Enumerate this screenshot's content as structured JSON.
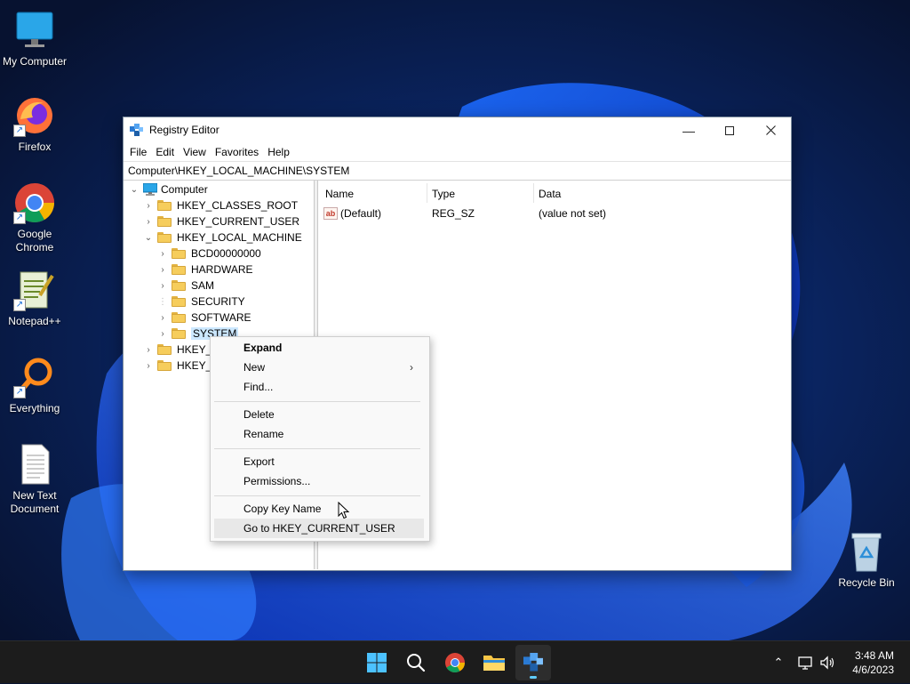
{
  "desktop": {
    "icons": [
      {
        "label": "My Computer",
        "icon": "monitor-icon"
      },
      {
        "label": "Firefox",
        "icon": "firefox-icon"
      },
      {
        "label": "Google Chrome",
        "icon": "chrome-icon"
      },
      {
        "label": "Notepad++",
        "icon": "notepadpp-icon"
      },
      {
        "label": "Everything",
        "icon": "everything-search-icon"
      },
      {
        "label": "New Text Document",
        "icon": "text-document-icon"
      },
      {
        "label": "Recycle Bin",
        "icon": "recycle-bin-icon"
      }
    ]
  },
  "window": {
    "title": "Registry Editor",
    "menu": [
      "File",
      "Edit",
      "View",
      "Favorites",
      "Help"
    ],
    "address": "Computer\\HKEY_LOCAL_MACHINE\\SYSTEM",
    "tree": [
      {
        "label": "Computer",
        "level": 0,
        "expanded": true
      },
      {
        "label": "HKEY_CLASSES_ROOT",
        "level": 1
      },
      {
        "label": "HKEY_CURRENT_USER",
        "level": 1
      },
      {
        "label": "HKEY_LOCAL_MACHINE",
        "level": 1,
        "expanded": true
      },
      {
        "label": "BCD00000000",
        "level": 2
      },
      {
        "label": "HARDWARE",
        "level": 2
      },
      {
        "label": "SAM",
        "level": 2
      },
      {
        "label": "SECURITY",
        "level": 2
      },
      {
        "label": "SOFTWARE",
        "level": 2
      },
      {
        "label": "SYSTEM",
        "level": 2,
        "selected": true
      },
      {
        "label": "HKEY_U",
        "level": 1
      },
      {
        "label": "HKEY_C",
        "level": 1
      }
    ],
    "columns": {
      "name": "Name",
      "type": "Type",
      "data": "Data"
    },
    "values": [
      {
        "name": "(Default)",
        "type": "REG_SZ",
        "data": "(value not set)"
      }
    ]
  },
  "context_menu": {
    "expand": "Expand",
    "new": "New",
    "find": "Find...",
    "delete": "Delete",
    "rename": "Rename",
    "export": "Export",
    "permissions": "Permissions...",
    "copy_key_name": "Copy Key Name",
    "goto": "Go to HKEY_CURRENT_USER"
  },
  "taskbar": {
    "apps": [
      "start-icon",
      "search-icon",
      "chrome-icon",
      "file-explorer-icon",
      "regedit-icon"
    ],
    "active_app": "regedit-icon"
  },
  "clock": {
    "time": "3:48 AM",
    "date": "4/6/2023"
  },
  "colors": {
    "accent": "#60cdff",
    "selection": "#cce8ff",
    "taskbar": "#1c1c1c"
  }
}
